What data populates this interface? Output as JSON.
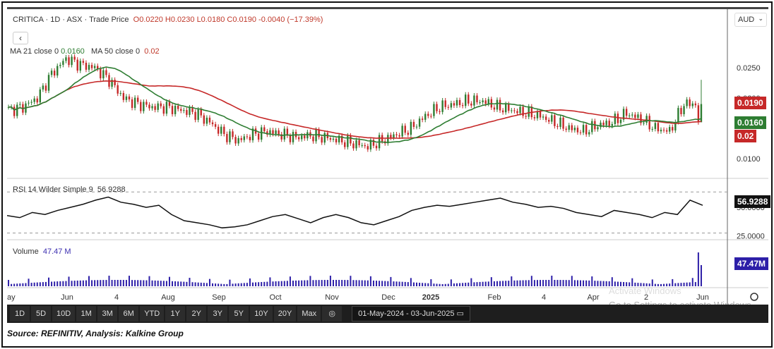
{
  "header": {
    "symbol": "CRITICA",
    "interval": "1D",
    "exchange": "ASX",
    "price_type": "Trade Price",
    "open": "O0.0220",
    "high": "H0.0230",
    "low": "L0.0180",
    "close": "C0.0190",
    "change": "-0.0040 (−17.39%)",
    "sep": "·",
    "back_label": "‹"
  },
  "ma_legend": {
    "ma21_label": "MA 21 close 0",
    "ma21_value": "0.0160",
    "ma50_label": "MA 50 close 0",
    "ma50_value": "0.02"
  },
  "currency": {
    "value": "AUD",
    "chevron": "⌄"
  },
  "price_axis": {
    "ticks": [
      "0.0250",
      "0.0200",
      "0.0100"
    ],
    "tag_close": "0.0190",
    "tag_ma21": "0.0160",
    "tag_ma50": "0.02"
  },
  "rsi": {
    "label": "RSI 14 Wilder Simple 9",
    "value": "56.9288",
    "tick_25": "25.0000",
    "tick_50": "50.0000"
  },
  "volume": {
    "label": "Volume",
    "value": "47.47 M",
    "tag": "47.47M"
  },
  "x_axis": [
    "ay",
    "Jun",
    "4",
    "Aug",
    "Sep",
    "Oct",
    "Nov",
    "Dec",
    "2025",
    "Feb",
    "4",
    "Apr",
    "2",
    "Jun"
  ],
  "watermark": {
    "line1": "Activate Windows",
    "line2": "Go to Settings to activate Windows."
  },
  "toolbar": {
    "ranges": [
      "1D",
      "5D",
      "10D",
      "1M",
      "3M",
      "6M",
      "YTD",
      "1Y",
      "2Y",
      "3Y",
      "5Y",
      "10Y",
      "20Y",
      "Max"
    ],
    "date_range": "01-May-2024 - 03-Jun-2025"
  },
  "source": "Source: REFINITIV, Analysis: Kalkine Group",
  "colors": {
    "up": "#2e7d32",
    "down": "#c62828",
    "ma21": "#2e7d32",
    "ma50": "#c62828",
    "volume": "#2d1fa8",
    "rsi": "#111111"
  },
  "chart_data": {
    "type": "candlestick",
    "price_closes_weekly": [
      0.018,
      0.0185,
      0.02,
      0.024,
      0.0265,
      0.0255,
      0.025,
      0.023,
      0.02,
      0.019,
      0.0185,
      0.0185,
      0.018,
      0.0175,
      0.016,
      0.014,
      0.013,
      0.014,
      0.0145,
      0.014,
      0.0135,
      0.0138,
      0.0135,
      0.013,
      0.0125,
      0.012,
      0.013,
      0.014,
      0.015,
      0.017,
      0.0185,
      0.019,
      0.0195,
      0.0195,
      0.0185,
      0.018,
      0.0175,
      0.017,
      0.016,
      0.015,
      0.0145,
      0.0155,
      0.016,
      0.0175,
      0.0165,
      0.015,
      0.0145,
      0.019
    ],
    "last_close": 0.019,
    "price_range": [
      0.008,
      0.029
    ],
    "rsi_values": [
      47,
      45,
      50,
      48,
      52,
      55,
      58,
      62,
      65,
      60,
      58,
      55,
      57,
      48,
      42,
      40,
      38,
      35,
      36,
      38,
      42,
      46,
      48,
      44,
      40,
      45,
      48,
      45,
      40,
      38,
      42,
      46,
      52,
      55,
      57,
      56,
      58,
      60,
      62,
      64,
      60,
      58,
      55,
      56,
      54,
      50,
      48,
      46,
      52,
      50,
      48,
      45,
      50,
      48,
      62,
      57
    ],
    "rsi_range": [
      20,
      75
    ],
    "rsi_levels": [
      30,
      70
    ]
  }
}
